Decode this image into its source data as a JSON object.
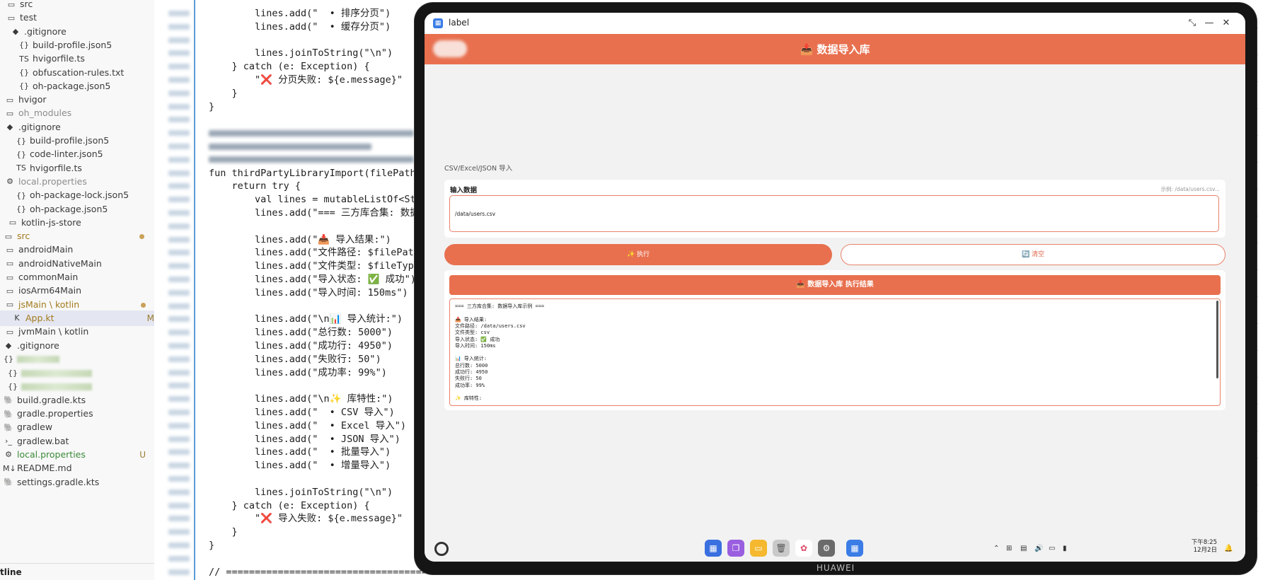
{
  "sidebar": {
    "items": [
      {
        "label": "src",
        "icon": "folder-icon",
        "cls": ""
      },
      {
        "label": "test",
        "icon": "folder-icon",
        "cls": ""
      },
      {
        "label": ".gitignore",
        "icon": "git-icon",
        "cls": ""
      },
      {
        "label": "build-profile.json5",
        "icon": "file-icon",
        "cls": ""
      },
      {
        "label": "hvigorfile.ts",
        "icon": "ts-icon",
        "cls": ""
      },
      {
        "label": "obfuscation-rules.txt",
        "icon": "file-icon",
        "cls": ""
      },
      {
        "label": "oh-package.json5",
        "icon": "file-icon",
        "cls": ""
      },
      {
        "label": "hvigor",
        "icon": "folder-icon",
        "cls": ""
      },
      {
        "label": "oh_modules",
        "icon": "folder-icon",
        "cls": "c-gray"
      },
      {
        "label": ".gitignore",
        "icon": "git-icon",
        "cls": ""
      },
      {
        "label": "build-profile.json5",
        "icon": "file-icon",
        "cls": ""
      },
      {
        "label": "code-linter.json5",
        "icon": "file-icon",
        "cls": ""
      },
      {
        "label": "hvigorfile.ts",
        "icon": "ts-icon",
        "cls": ""
      },
      {
        "label": "local.properties",
        "icon": "gear-icon",
        "cls": "c-gray"
      },
      {
        "label": "oh-package-lock.json5",
        "icon": "file-icon",
        "cls": ""
      },
      {
        "label": "oh-package.json5",
        "icon": "file-icon",
        "cls": ""
      },
      {
        "label": "kotlin-js-store",
        "icon": "folder-icon",
        "cls": ""
      },
      {
        "label": "src",
        "icon": "folder-icon",
        "cls": "c-amber"
      },
      {
        "label": "androidMain",
        "icon": "folder-icon",
        "cls": ""
      },
      {
        "label": "androidNativeMain",
        "icon": "folder-icon",
        "cls": ""
      },
      {
        "label": "commonMain",
        "icon": "folder-icon",
        "cls": ""
      },
      {
        "label": "iosArm64Main",
        "icon": "folder-icon",
        "cls": ""
      },
      {
        "label": "jsMain \\ kotlin",
        "icon": "folder-icon",
        "cls": "c-amber"
      },
      {
        "label": "App.kt",
        "icon": "kotlin-icon",
        "cls": "c-amber"
      },
      {
        "label": "jvmMain \\ kotlin",
        "icon": "folder-icon",
        "cls": ""
      },
      {
        "label": ".gitignore",
        "icon": "git-icon",
        "cls": ""
      },
      {
        "label": "",
        "icon": "file-icon",
        "cls": ""
      },
      {
        "label": "",
        "icon": "file-icon",
        "cls": ""
      },
      {
        "label": "",
        "icon": "file-icon",
        "cls": ""
      },
      {
        "label": "build.gradle.kts",
        "icon": "gradle-icon",
        "cls": ""
      },
      {
        "label": "gradle.properties",
        "icon": "gradle-icon",
        "cls": ""
      },
      {
        "label": "gradlew",
        "icon": "gradle-icon",
        "cls": ""
      },
      {
        "label": "gradlew.bat",
        "icon": "terminal-icon",
        "cls": ""
      },
      {
        "label": "local.properties",
        "icon": "gear-icon",
        "cls": "c-green"
      },
      {
        "label": "README.md",
        "icon": "markdown-icon",
        "cls": ""
      },
      {
        "label": "settings.gradle.kts",
        "icon": "gradle-icon",
        "cls": ""
      }
    ],
    "badge_m": "M",
    "badge_u": "U",
    "outline": "tline"
  },
  "editor": {
    "lines": [
      "        lines.add(\"  • 排序分页\")",
      "        lines.add(\"  • 缓存分页\")",
      "",
      "        lines.joinToString(\"\\n\")",
      "    } catch (e: Exception) {",
      "        \"❌ 分页失败: ${e.message}\"",
      "    }",
      "}",
      "",
      "",
      "",
      "",
      "fun thirdPartyLibraryImport(filePath:",
      "    return try {",
      "        val lines = mutableListOf<Stri",
      "        lines.add(\"=== 三方库合集: 数据",
      "",
      "        lines.add(\"📥 导入结果:\")",
      "        lines.add(\"文件路径: $filePath\"",
      "        lines.add(\"文件类型: $fileType\"",
      "        lines.add(\"导入状态: ✅ 成功\")",
      "        lines.add(\"导入时间: 150ms\")",
      "",
      "        lines.add(\"\\n📊 导入统计:\")",
      "        lines.add(\"总行数: 5000\")",
      "        lines.add(\"成功行: 4950\")",
      "        lines.add(\"失败行: 50\")",
      "        lines.add(\"成功率: 99%\")",
      "",
      "        lines.add(\"\\n✨ 库特性:\")",
      "        lines.add(\"  • CSV 导入\")",
      "        lines.add(\"  • Excel 导入\")",
      "        lines.add(\"  • JSON 导入\")",
      "        lines.add(\"  • 批量导入\")",
      "        lines.add(\"  • 增量导入\")",
      "",
      "        lines.joinToString(\"\\n\")",
      "    } catch (e: Exception) {",
      "        \"❌ 导入失败: ${e.message}\"",
      "    }",
      "}",
      "",
      "// ====================================================================="
    ]
  },
  "device": {
    "brand": "HUAWEI",
    "window_title": "label",
    "header_title": "📥 数据导入库",
    "section_label": "CSV/Excel/JSON 导入",
    "input_label": "输入数据",
    "input_hint": "示例: /data/users.csv...",
    "input_value": "/data/users.csv",
    "run_button": "✨ 执行",
    "clear_button": "🔄 清空",
    "result_title": "📥 数据导入库 执行结果",
    "result_lines": [
      "=== 三方库合集: 数据导入库示例 ===",
      "",
      "📥 导入结果:",
      "文件路径: /data/users.csv",
      "文件类型: csv",
      "导入状态: ✅ 成功",
      "导入时间: 150ms",
      "",
      "📊 导入统计:",
      "总行数: 5000",
      "成功行: 4950",
      "失败行: 50",
      "成功率: 99%",
      "",
      "✨ 库特性:"
    ],
    "clock_time": "下午8:25",
    "clock_date": "12月2日",
    "colors": {
      "accent": "#e8704f",
      "border": "#e8826a"
    }
  }
}
